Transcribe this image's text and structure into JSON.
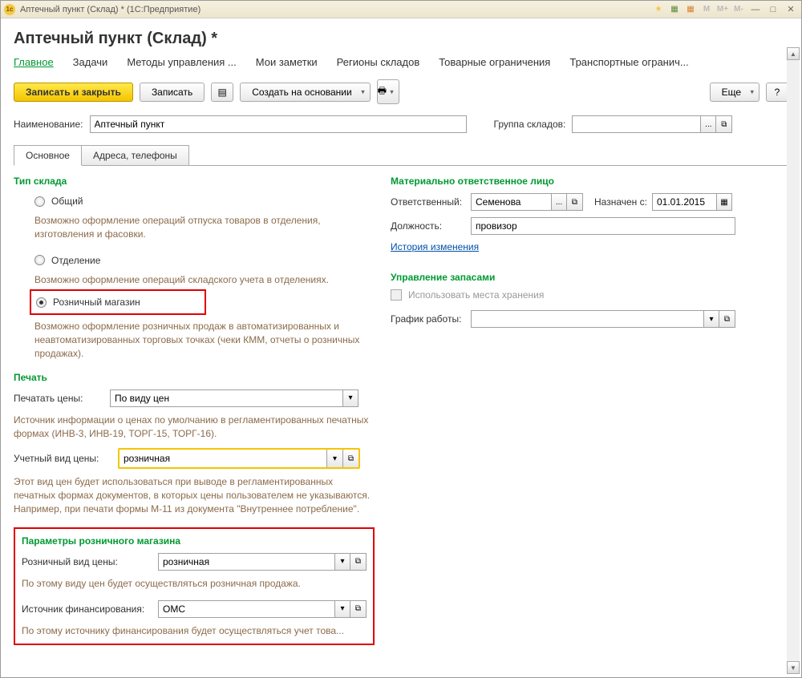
{
  "titlebar": {
    "text": "Аптечный пункт (Склад) *   (1С:Предприятие)"
  },
  "page_title": "Аптечный пункт (Склад) *",
  "nav": {
    "tabs": [
      "Главное",
      "Задачи",
      "Методы управления ...",
      "Мои заметки",
      "Регионы складов",
      "Товарные ограничения",
      "Транспортные огранич..."
    ]
  },
  "toolbar": {
    "save_close": "Записать и закрыть",
    "save": "Записать",
    "create_based": "Создать на основании",
    "more": "Еще",
    "help": "?"
  },
  "name_field": {
    "label": "Наименование:",
    "value": "Аптечный пункт"
  },
  "group_field": {
    "label": "Группа складов:"
  },
  "inner_tabs": [
    "Основное",
    "Адреса, телефоны"
  ],
  "wh_type": {
    "title": "Тип склада",
    "opt_common": "Общий",
    "help_common": "Возможно оформление операций отпуска товаров в отделения, изготовления и фасовки.",
    "opt_dept": "Отделение",
    "help_dept": "Возможно оформление операций складского учета в отделениях.",
    "opt_retail": "Розничный магазин",
    "help_retail": "Возможно оформление розничных продаж в автоматизированных и неавтоматизированных торговых точках (чеки КММ, отчеты о розничных продажах)."
  },
  "print": {
    "title": "Печать",
    "price_print_label": "Печатать цены:",
    "price_print_value": "По виду цен",
    "help_source": "Источник информации о ценах по умолчанию в регламентированных печатных формах (ИНВ-3, ИНВ-19, ТОРГ-15, ТОРГ-16).",
    "acc_price_label": "Учетный вид цены:",
    "acc_price_value": "розничная",
    "help_acc": "Этот вид цен будет использоваться при выводе в регламентированных печатных формах документов, в которых цены пользователем не указываются. Например, при печати формы М-11 из документа \"Внутреннее потребление\"."
  },
  "retail": {
    "title": "Параметры розничного магазина",
    "price_label": "Розничный вид цены:",
    "price_value": "розничная",
    "help_price": "По этому виду цен будет осуществляться розничная продажа.",
    "fin_label": "Источник финансирования:",
    "fin_value": "ОМС",
    "help_fin": "По этому источнику финансирования будет осуществляться учет това..."
  },
  "mol": {
    "title": "Материально ответственное лицо",
    "resp_label": "Ответственный:",
    "resp_value": "Семенова",
    "from_label": "Назначен с:",
    "from_value": "01.01.2015",
    "job_label": "Должность:",
    "job_value": "провизор",
    "history": "История изменения"
  },
  "stock": {
    "title": "Управление запасами",
    "use_places": "Использовать места хранения",
    "schedule_label": "График работы:"
  }
}
